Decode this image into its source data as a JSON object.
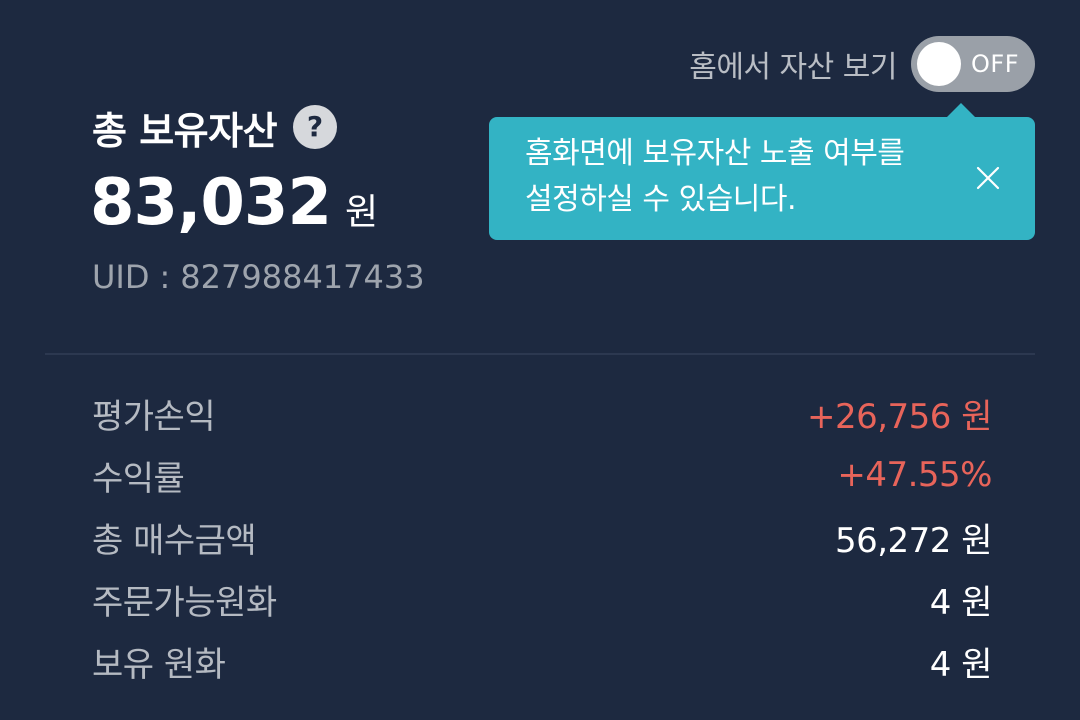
{
  "home_toggle": {
    "label": "홈에서 자산 보기",
    "state_text": "OFF"
  },
  "tooltip": {
    "line1": "홈화면에 보유자산 노출 여부를",
    "line2": "설정하실 수 있습니다.",
    "close_icon": "close-icon"
  },
  "total": {
    "title": "총 보유자산",
    "help_icon": "?",
    "amount": "83,032",
    "unit": "원",
    "uid_label": "UID",
    "uid_sep": ":",
    "uid_value": "827988417433"
  },
  "stats": [
    {
      "label": "평가손익",
      "value": "+26,756 원"
    },
    {
      "label": "수익률",
      "value": "+47.55%"
    },
    {
      "label": "총 매수금액",
      "value": "56,272 원"
    },
    {
      "label": "주문가능원화",
      "value": "4 원"
    },
    {
      "label": "보유 원화",
      "value": "4 원"
    }
  ],
  "colors": {
    "background": "#1d2940",
    "tooltip": "#33b3c4",
    "positive": "#e8645a",
    "toggle_off": "#9aa0a8"
  }
}
